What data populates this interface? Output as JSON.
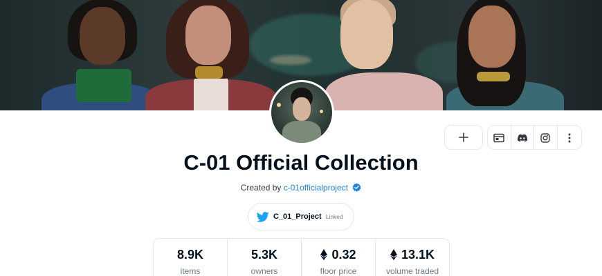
{
  "collection": {
    "title": "C-01 Official Collection",
    "created_prefix": "Created by",
    "creator": "c-01officialproject"
  },
  "twitter": {
    "handle": "C_01_Project",
    "status": "Linked"
  },
  "stats": [
    {
      "value": "8.9K",
      "label": "items",
      "eth": false
    },
    {
      "value": "5.3K",
      "label": "owners",
      "eth": false
    },
    {
      "value": "0.32",
      "label": "floor price",
      "eth": true
    },
    {
      "value": "13.1K",
      "label": "volume traded",
      "eth": true
    }
  ],
  "icons": {
    "add": "plus-icon",
    "website": "website-icon",
    "discord": "discord-icon",
    "instagram": "instagram-icon",
    "more": "more-vertical-icon",
    "verified": "verified-badge-icon",
    "twitter": "twitter-bird-icon",
    "eth": "ethereum-icon"
  },
  "colors": {
    "link": "#2081e2",
    "twitter": "#1da1f2",
    "text": "#04111d",
    "muted": "#707a83"
  }
}
